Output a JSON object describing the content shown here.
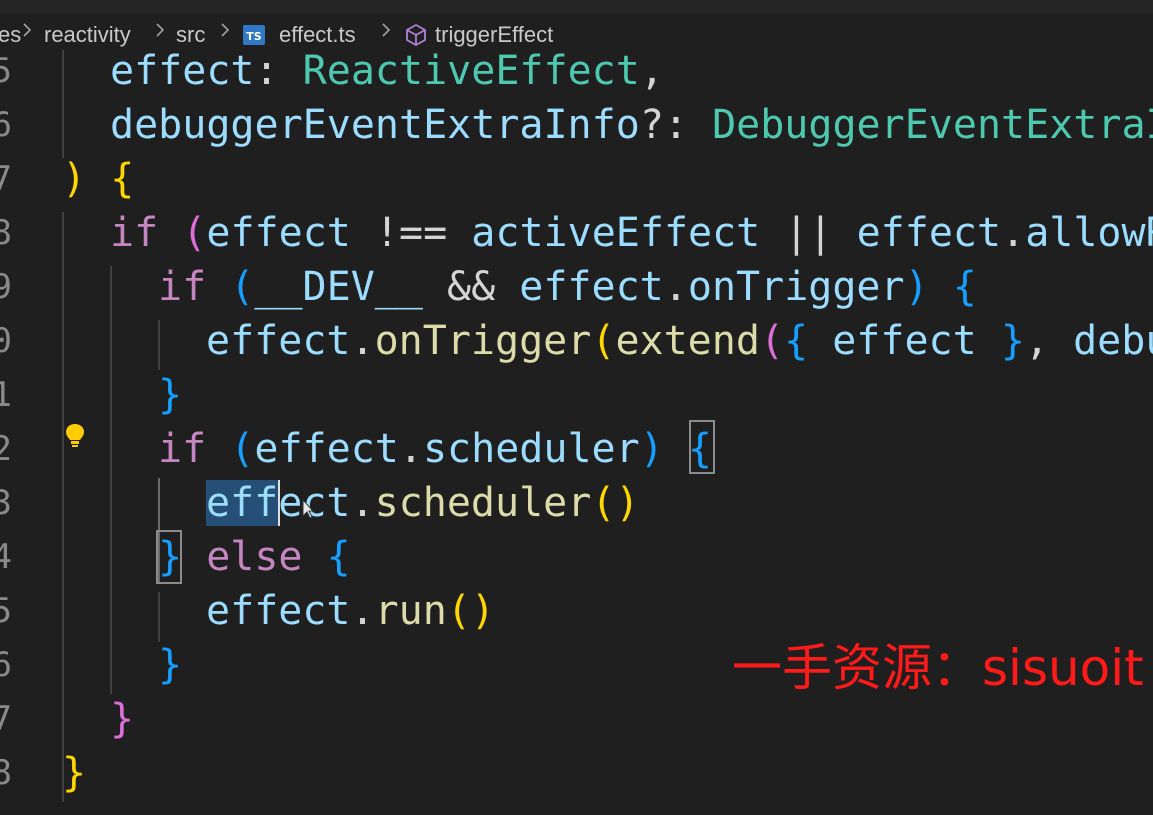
{
  "breadcrumb": {
    "items": [
      "es",
      "reactivity",
      "src",
      "effect.ts",
      "triggerEffect"
    ],
    "file_badge": "TS"
  },
  "gutter": {
    "line_numbers": [
      "5",
      "6",
      "7",
      "8",
      "9",
      "0",
      "1",
      "2",
      "3",
      "4",
      "5",
      "6",
      "7",
      "8"
    ]
  },
  "code": {
    "lines": [
      [
        {
          "t": "effect",
          "c": "var"
        },
        {
          "t": ": ",
          "c": "plain"
        },
        {
          "t": "ReactiveEffect",
          "c": "type"
        },
        {
          "t": ",",
          "c": "plain"
        }
      ],
      [
        {
          "t": "debuggerEventExtraInfo",
          "c": "var"
        },
        {
          "t": "?: ",
          "c": "plain"
        },
        {
          "t": "DebuggerEventExtraInfo",
          "c": "type"
        }
      ],
      [
        {
          "t": ")",
          "c": "b1"
        },
        {
          "t": " ",
          "c": "plain"
        },
        {
          "t": "{",
          "c": "b1"
        }
      ],
      [
        {
          "t": "if",
          "c": "kw"
        },
        {
          "t": " ",
          "c": "plain"
        },
        {
          "t": "(",
          "c": "b2"
        },
        {
          "t": "effect",
          "c": "var"
        },
        {
          "t": " !== ",
          "c": "plain"
        },
        {
          "t": "activeEffect",
          "c": "var"
        },
        {
          "t": " || ",
          "c": "plain"
        },
        {
          "t": "effect",
          "c": "var"
        },
        {
          "t": ".",
          "c": "plain"
        },
        {
          "t": "allowRecurse",
          "c": "var"
        }
      ],
      [
        {
          "t": "if",
          "c": "kw"
        },
        {
          "t": " ",
          "c": "plain"
        },
        {
          "t": "(",
          "c": "b3"
        },
        {
          "t": "__DEV__",
          "c": "var"
        },
        {
          "t": " && ",
          "c": "plain"
        },
        {
          "t": "effect",
          "c": "var"
        },
        {
          "t": ".",
          "c": "plain"
        },
        {
          "t": "onTrigger",
          "c": "var"
        },
        {
          "t": ")",
          "c": "b3"
        },
        {
          "t": " ",
          "c": "plain"
        },
        {
          "t": "{",
          "c": "b3"
        }
      ],
      [
        {
          "t": "effect",
          "c": "var"
        },
        {
          "t": ".",
          "c": "plain"
        },
        {
          "t": "onTrigger",
          "c": "fn"
        },
        {
          "t": "(",
          "c": "b1"
        },
        {
          "t": "extend",
          "c": "fn"
        },
        {
          "t": "(",
          "c": "b2"
        },
        {
          "t": "{",
          "c": "b3"
        },
        {
          "t": " ",
          "c": "plain"
        },
        {
          "t": "effect",
          "c": "var"
        },
        {
          "t": " ",
          "c": "plain"
        },
        {
          "t": "}",
          "c": "b3"
        },
        {
          "t": ", ",
          "c": "plain"
        },
        {
          "t": "debuggerEventExtraInfo",
          "c": "var"
        }
      ],
      [
        {
          "t": "}",
          "c": "b3"
        }
      ],
      [
        {
          "t": "if",
          "c": "kw"
        },
        {
          "t": " ",
          "c": "plain"
        },
        {
          "t": "(",
          "c": "b3"
        },
        {
          "t": "effect",
          "c": "var"
        },
        {
          "t": ".",
          "c": "plain"
        },
        {
          "t": "scheduler",
          "c": "var"
        },
        {
          "t": ")",
          "c": "b3"
        },
        {
          "t": " ",
          "c": "plain"
        },
        {
          "t": "{",
          "c": "b3"
        }
      ],
      [
        {
          "t": "effect",
          "c": "var"
        },
        {
          "t": ".",
          "c": "plain"
        },
        {
          "t": "scheduler",
          "c": "fn"
        },
        {
          "t": "()",
          "c": "b1"
        }
      ],
      [
        {
          "t": "}",
          "c": "b3"
        },
        {
          "t": " ",
          "c": "plain"
        },
        {
          "t": "else",
          "c": "kw"
        },
        {
          "t": " ",
          "c": "plain"
        },
        {
          "t": "{",
          "c": "b3"
        }
      ],
      [
        {
          "t": "effect",
          "c": "var"
        },
        {
          "t": ".",
          "c": "plain"
        },
        {
          "t": "run",
          "c": "fn"
        },
        {
          "t": "()",
          "c": "b1"
        }
      ],
      [
        {
          "t": "}",
          "c": "b3"
        }
      ],
      [
        {
          "t": "}",
          "c": "b2"
        }
      ],
      [
        {
          "t": "}",
          "c": "b1"
        }
      ]
    ],
    "indents": [
      1,
      1,
      0,
      1,
      2,
      3,
      2,
      2,
      3,
      2,
      3,
      2,
      1,
      0
    ]
  },
  "watermark": "一手资源：sisuoit",
  "colors": {
    "background": "#1f1f1f",
    "variable": "#9cdcfe",
    "type": "#4ec9b0",
    "keyword": "#c586c0",
    "function": "#dcdcaa",
    "bracket_level_1": "#ffd700",
    "bracket_level_2": "#da70d6",
    "bracket_level_3": "#179fff",
    "selection": "#264f78",
    "watermark": "#ff1a1a"
  }
}
